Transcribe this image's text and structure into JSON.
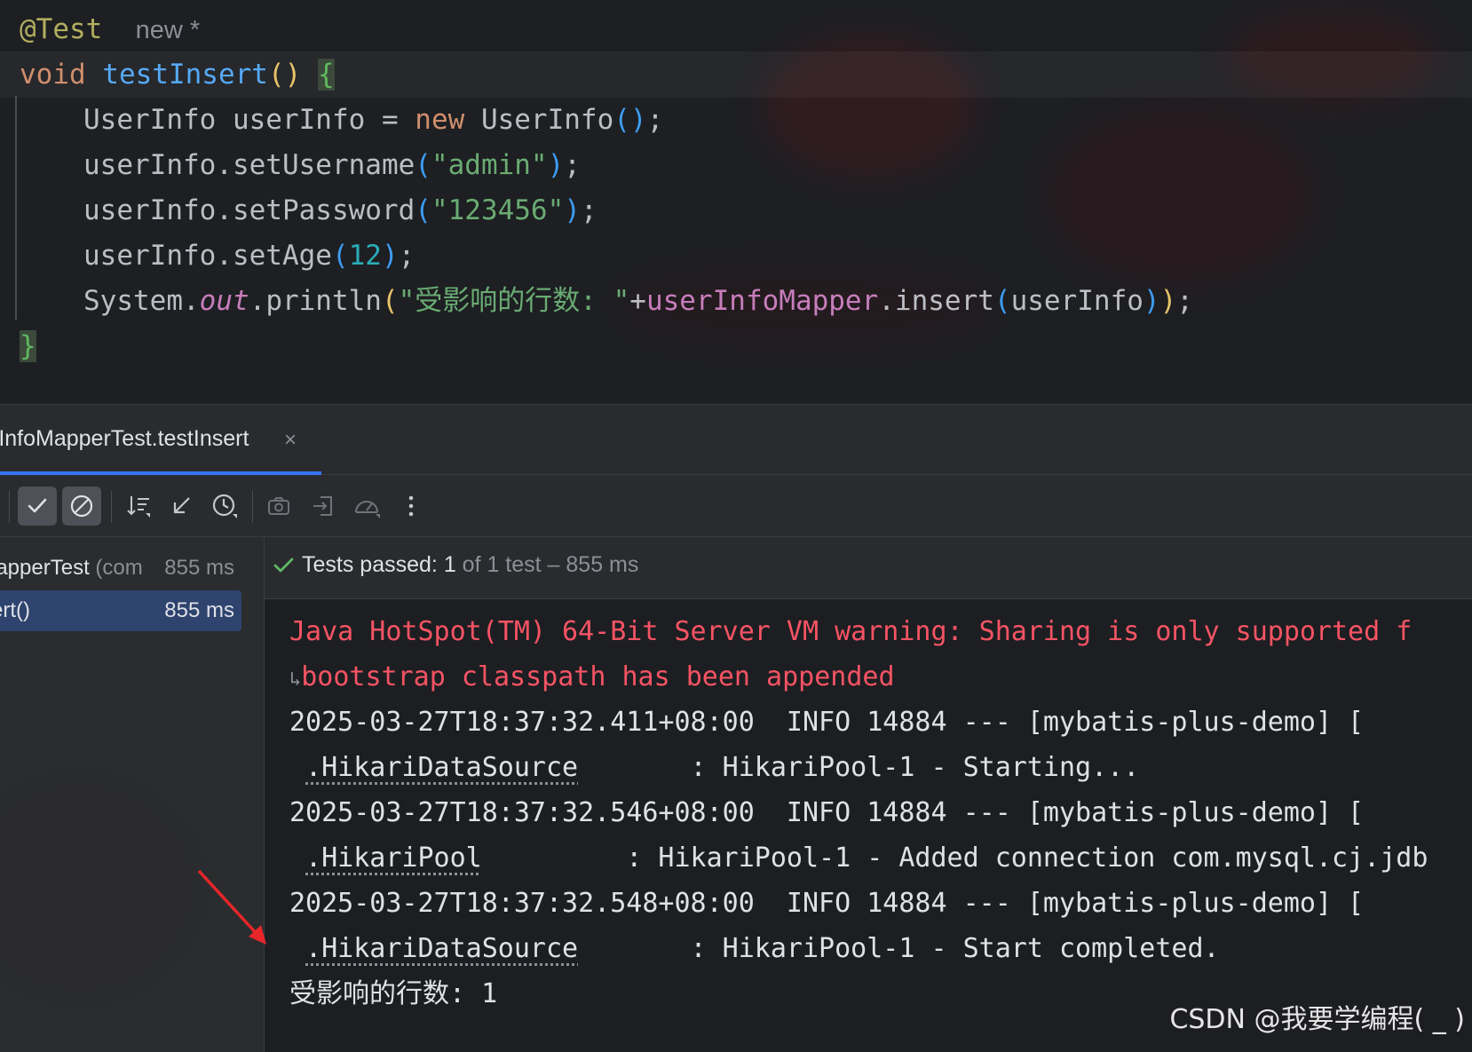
{
  "editor": {
    "annotation": "@Test",
    "usage_hint": "new *",
    "lines": {
      "sig_void": "void",
      "sig_name": "testInsert",
      "sig_parens": "()",
      "sig_brace": "{",
      "l1_type": "UserInfo userInfo = ",
      "l1_new": "new",
      "l1_ctor": " UserInfo",
      "l1_parens": "()",
      "l1_semi": ";",
      "l2_call": "userInfo.setUsername",
      "l2_open": "(",
      "l2_str": "\"admin\"",
      "l2_close": ")",
      "l2_semi": ";",
      "l3_call": "userInfo.setPassword",
      "l3_open": "(",
      "l3_str": "\"123456\"",
      "l3_close": ")",
      "l3_semi": ";",
      "l4_call": "userInfo.setAge",
      "l4_open": "(",
      "l4_num": "12",
      "l4_close": ")",
      "l4_semi": ";",
      "l5_sys": "System.",
      "l5_out": "out",
      "l5_println": ".println",
      "l5_open": "(",
      "l5_str": "\"受影响的行数: \"",
      "l5_plus": "+",
      "l5_mapper": "userInfoMapper",
      "l5_insert": ".insert",
      "l5_open2": "(",
      "l5_arg": "userInfo",
      "l5_close2": ")",
      "l5_close": ")",
      "l5_semi": ";",
      "end_brace": "}"
    }
  },
  "run_panel": {
    "tab_title": "rInfoMapperTest.testInsert",
    "tab_close": "×",
    "toolbar": {
      "icons": [
        "passed-filter-icon",
        "ignored-filter-icon",
        "sort-icon",
        "collapse-icon",
        "history-icon",
        "screenshot-icon",
        "export-icon",
        "profiler-icon",
        "more-icon"
      ]
    },
    "tree": {
      "root_name": "lapperTest",
      "root_pkg": " (com",
      "root_time": "855 ms",
      "child_name": "ert()",
      "child_time": "855 ms"
    },
    "status": {
      "label": "Tests passed: ",
      "count": "1",
      "rest": " of 1 test – 855 ms"
    },
    "console": {
      "warn1": "Java HotSpot(TM) 64-Bit Server VM warning: Sharing is only supported f",
      "warn2": "bootstrap classpath has been appended",
      "log1a": "2025-03-27T18:37:32.411+08:00  INFO 14884 --- [mybatis-plus-demo] [",
      "log1b_class": ".HikariDataSource",
      "log1b_msg": "       : HikariPool-1 - Starting...",
      "log2a": "2025-03-27T18:37:32.546+08:00  INFO 14884 --- [mybatis-plus-demo] [",
      "log2b_class": ".HikariPool",
      "log2b_msg": "         : HikariPool-1 - Added connection com.mysql.cj.jdb",
      "log3a": "2025-03-27T18:37:32.548+08:00  INFO 14884 --- [mybatis-plus-demo] [",
      "log3b_class": ".HikariDataSource",
      "log3b_msg": "       : HikariPool-1 - Start completed.",
      "result": "受影响的行数: 1"
    }
  },
  "watermark": "CSDN @我要学编程( _ )",
  "colors": {
    "accent": "#3574f0",
    "error": "#f75464",
    "pass": "#5fb865",
    "arrow": "#e8262a"
  }
}
